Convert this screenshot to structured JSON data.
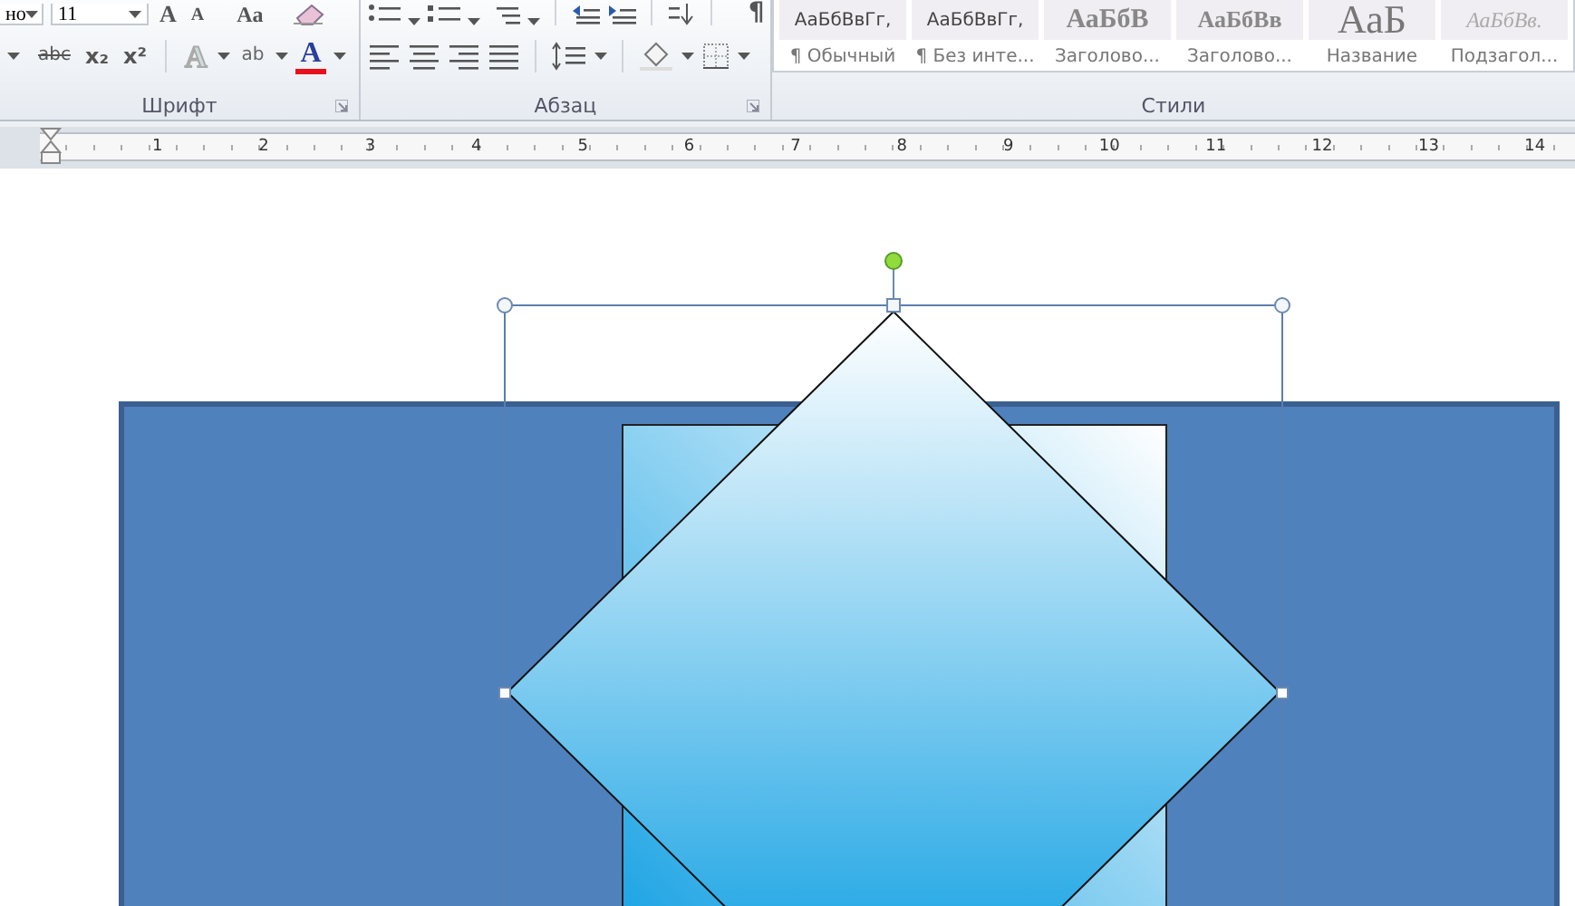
{
  "ribbon": {
    "font": {
      "font_name": "но",
      "font_size": "11",
      "size_buttons": [
        "A",
        "A",
        "Aa"
      ],
      "format_buttons": [
        {
          "kind": "strike",
          "glyph": "abc"
        },
        {
          "kind": "sub",
          "glyph": "x₂"
        },
        {
          "kind": "sup",
          "glyph": "x²"
        }
      ],
      "effects_glyph": "A",
      "highlight_glyph": "ab",
      "color_glyph": "A",
      "label": "Шрифт"
    },
    "paragraph": {
      "mark_glyph": "¶",
      "label": "Абзац"
    },
    "styles": {
      "items": [
        {
          "preview": "АаБбВвГг,",
          "name": "¶ Обычный",
          "kind": "normal"
        },
        {
          "preview": "АаБбВвГг,",
          "name": "¶ Без инте...",
          "kind": "normal"
        },
        {
          "preview": "АаБбВ",
          "name": "Заголово...",
          "kind": "heading1"
        },
        {
          "preview": "АаБбВв",
          "name": "Заголово...",
          "kind": "heading2"
        },
        {
          "preview": "АаБ",
          "name": "Название",
          "kind": "title"
        },
        {
          "preview": "АаБбВв.",
          "name": "Подзагол...",
          "kind": "subtitle"
        }
      ],
      "label": "Стили"
    }
  },
  "ruler": {
    "marks": [
      "1",
      "2",
      "3",
      "4",
      "5",
      "6",
      "7",
      "8",
      "9",
      "10",
      "11",
      "12",
      "13",
      "14"
    ]
  },
  "canvas": {
    "shape": {
      "selected": true
    }
  }
}
